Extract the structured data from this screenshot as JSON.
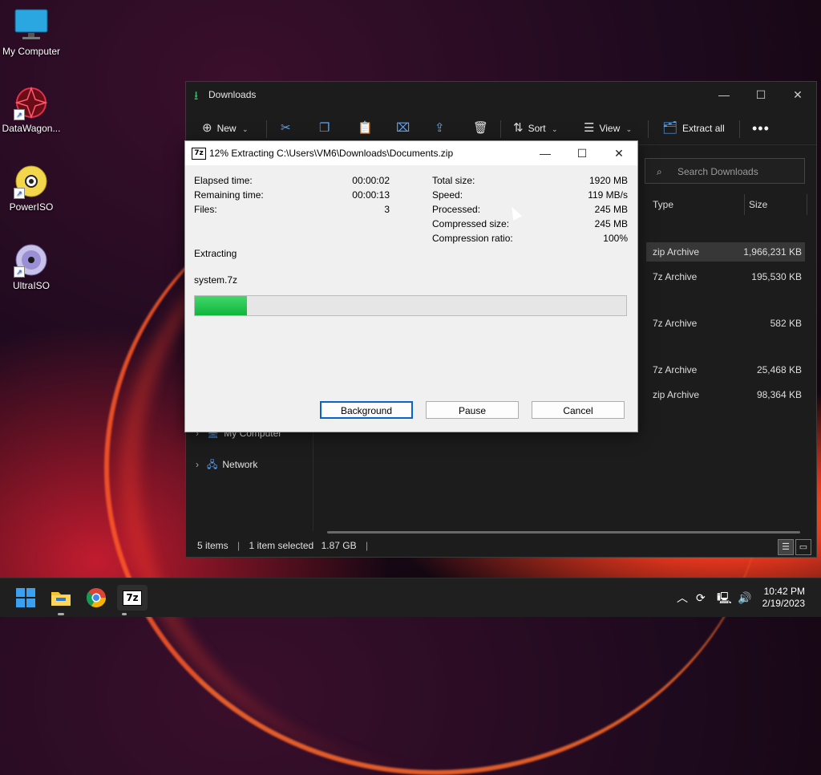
{
  "desktop": {
    "icons": [
      {
        "label": "My Computer"
      },
      {
        "label": "DataWagon..."
      },
      {
        "label": "PowerISO"
      },
      {
        "label": "UltraISO"
      }
    ]
  },
  "explorer": {
    "title": "Downloads",
    "toolbar": {
      "new": "New",
      "sort": "Sort",
      "view": "View",
      "extract_all": "Extract all"
    },
    "search_placeholder": "Search Downloads",
    "columns": {
      "type": "Type",
      "size": "Size"
    },
    "rows": [
      {
        "type": "zip Archive",
        "size": "1,966,231 KB",
        "selected": true
      },
      {
        "type": "7z Archive",
        "size": "195,530 KB"
      },
      {
        "type": "7z Archive",
        "size": "582 KB"
      },
      {
        "type": "7z Archive",
        "size": "25,468 KB"
      },
      {
        "type": "zip Archive",
        "size": "98,364 KB"
      }
    ],
    "nav": [
      {
        "label": "My Computer"
      },
      {
        "label": "Network"
      }
    ],
    "status": {
      "items": "5 items",
      "selected": "1 item selected",
      "size": "1.87 GB"
    }
  },
  "dialog": {
    "title": "12% Extracting C:\\Users\\VM6\\Downloads\\Documents.zip",
    "progress_percent": 12,
    "left_stats": [
      {
        "label": "Elapsed time:",
        "value": "00:00:02"
      },
      {
        "label": "Remaining time:",
        "value": "00:00:13"
      },
      {
        "label": "Files:",
        "value": "3"
      }
    ],
    "right_stats": [
      {
        "label": "Total size:",
        "value": "1920 MB"
      },
      {
        "label": "Speed:",
        "value": "119 MB/s"
      },
      {
        "label": "Processed:",
        "value": "245 MB"
      },
      {
        "label": "Compressed size:",
        "value": "245 MB"
      },
      {
        "label": "Compression ratio:",
        "value": "100%"
      }
    ],
    "operation": "Extracting",
    "current_file": "system.7z",
    "buttons": {
      "background": "Background",
      "pause": "Pause",
      "cancel": "Cancel"
    }
  },
  "taskbar": {
    "time": "10:42 PM",
    "date": "2/19/2023",
    "app_7z_label": "7z"
  }
}
